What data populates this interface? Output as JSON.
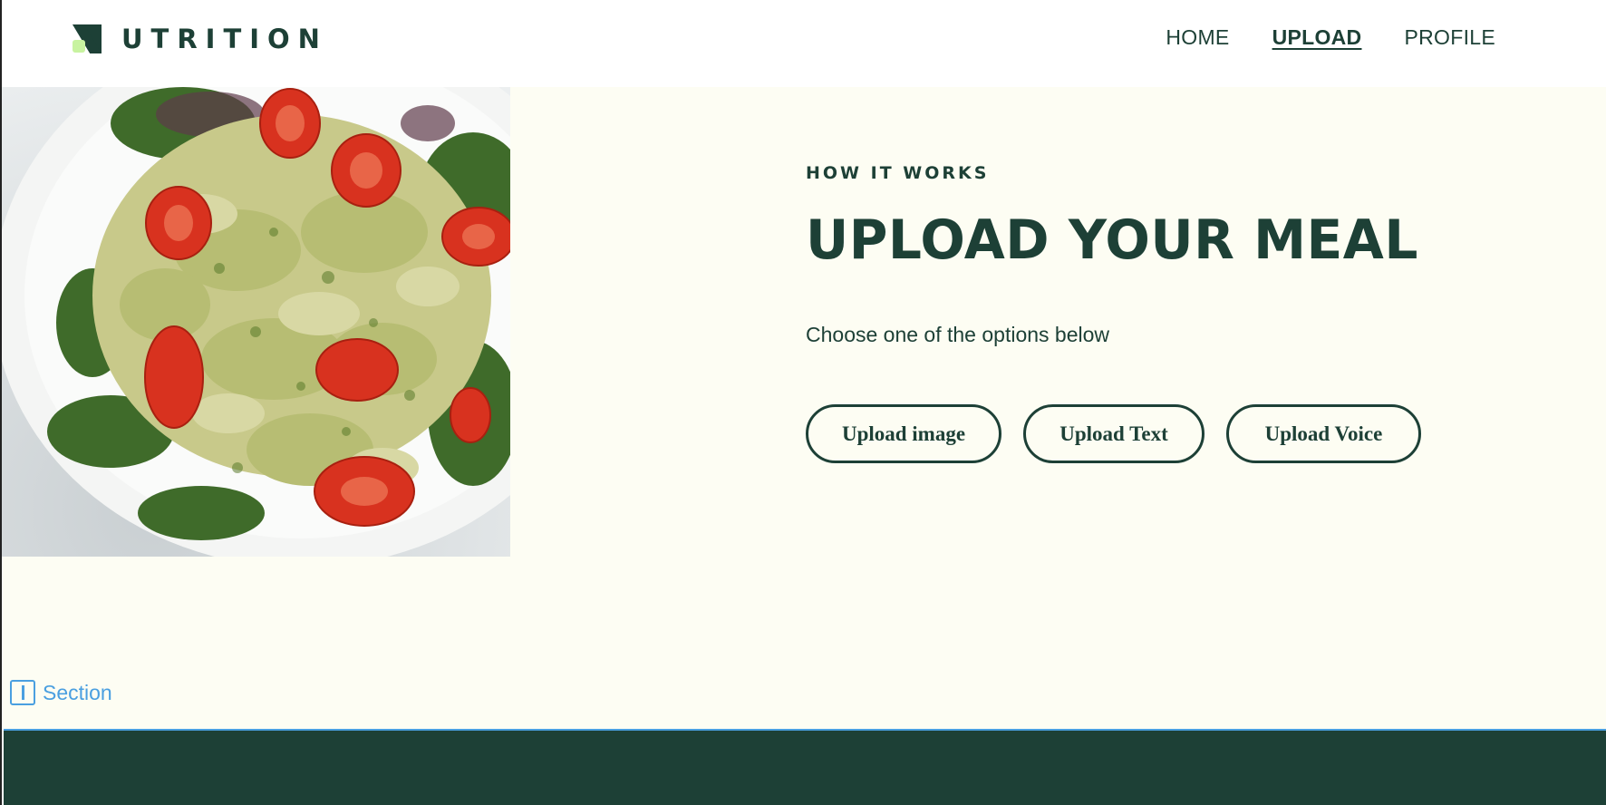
{
  "brand": {
    "name": "UTRITION",
    "colors": {
      "primary": "#1d4036",
      "accent": "#c8f3a0",
      "background": "#fdfdf3",
      "selection": "#4a9fe0"
    }
  },
  "nav": {
    "items": [
      {
        "label": "HOME",
        "active": false
      },
      {
        "label": "UPLOAD",
        "active": true
      },
      {
        "label": "PROFILE",
        "active": false
      }
    ]
  },
  "hero": {
    "image_icon": "pasta-salad-photo",
    "eyebrow": "HOW IT WORKS",
    "title": "UPLOAD YOUR MEAL",
    "subtitle": "Choose one of the options below",
    "buttons": {
      "upload_image": "Upload image",
      "upload_text": "Upload Text",
      "upload_voice": "Upload Voice"
    }
  },
  "editor": {
    "section_label": "Section",
    "section_icon": "section-icon"
  }
}
